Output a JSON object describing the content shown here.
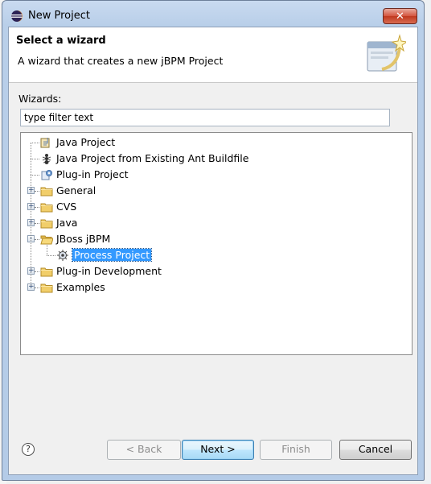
{
  "window": {
    "title": "New Project",
    "close_glyph": "✕"
  },
  "banner": {
    "title": "Select a wizard",
    "description": "A wizard that creates a new jBPM Project",
    "image_icon": "wizard-banner-icon"
  },
  "wizards": {
    "label": "Wizards:",
    "filter_value": "type filter text"
  },
  "tree": {
    "items": [
      {
        "label": "Java Project",
        "icon": "java-project-icon",
        "level": 0,
        "expander": null
      },
      {
        "label": "Java Project from Existing Ant Buildfile",
        "icon": "ant-icon",
        "level": 0,
        "expander": null
      },
      {
        "label": "Plug-in Project",
        "icon": "plugin-project-icon",
        "level": 0,
        "expander": null
      },
      {
        "label": "General",
        "icon": "folder-icon",
        "level": 0,
        "expander": "+"
      },
      {
        "label": "CVS",
        "icon": "folder-icon",
        "level": 0,
        "expander": "+"
      },
      {
        "label": "Java",
        "icon": "folder-icon",
        "level": 0,
        "expander": "+"
      },
      {
        "label": "JBoss jBPM",
        "icon": "folder-open-icon",
        "level": 0,
        "expander": "-"
      },
      {
        "label": "Process Project",
        "icon": "process-project-icon",
        "level": 1,
        "expander": null,
        "selected": true
      },
      {
        "label": "Plug-in Development",
        "icon": "folder-icon",
        "level": 0,
        "expander": "+"
      },
      {
        "label": "Examples",
        "icon": "folder-icon",
        "level": 0,
        "expander": "+"
      }
    ]
  },
  "footer": {
    "help_glyph": "?",
    "back_label": "< Back",
    "next_label": "Next >",
    "finish_label": "Finish",
    "cancel_label": "Cancel"
  },
  "colors": {
    "selection": "#3399ff",
    "folder": "#e8c15a",
    "titlebar": "#b9cfe9"
  }
}
